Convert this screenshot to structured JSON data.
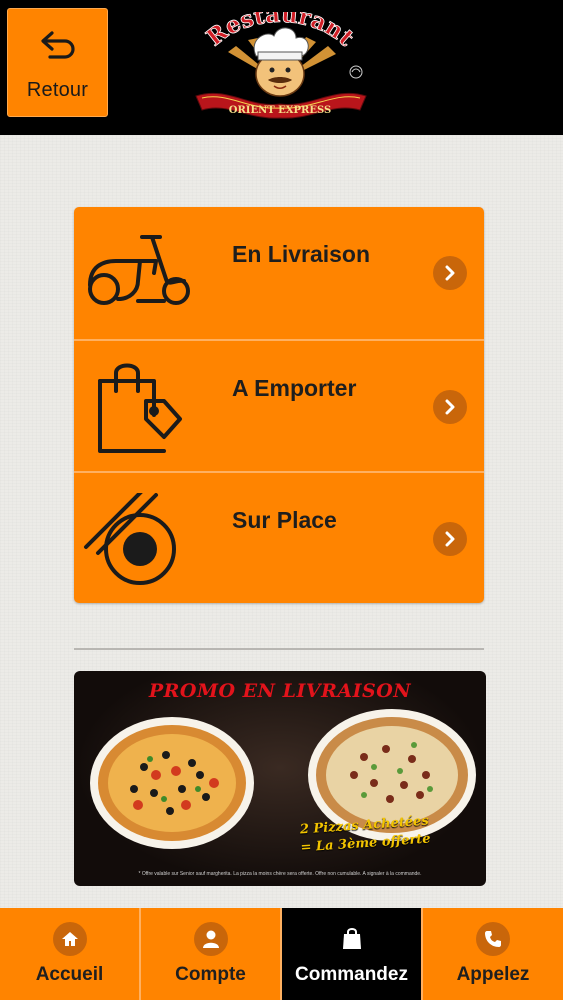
{
  "header": {
    "back_label": "Retour",
    "logo": {
      "top_text": "Restaurant",
      "banner_text": "ORIENT EXPRESS"
    }
  },
  "menu": {
    "items": [
      {
        "label": "En Livraison",
        "icon": "scooter-icon"
      },
      {
        "label": "A Emporter",
        "icon": "shopping-bag-tag-icon"
      },
      {
        "label": "Sur Place",
        "icon": "bowl-chopsticks-icon"
      }
    ],
    "chevron_icon": "chevron-right-icon"
  },
  "promo": {
    "title": "PROMO EN LIVRAISON",
    "offer_line1": "2 Pizzas Achetées",
    "offer_line2": "= La 3ème offerte",
    "fine_print": "* Offre valable sur Senior sauf margherita. La pizza la moins chère sera offerte. Offre non cumulable. A signaler à la commande."
  },
  "bottom_nav": {
    "tabs": [
      {
        "label": "Accueil",
        "icon": "home-icon"
      },
      {
        "label": "Compte",
        "icon": "user-icon"
      },
      {
        "label": "Commandez",
        "icon": "shopping-bag-icon",
        "active": true
      },
      {
        "label": "Appelez",
        "icon": "phone-icon"
      }
    ]
  },
  "colors": {
    "accent": "#ff8400",
    "accent_dark": "#c9660a",
    "header_bg": "#000000",
    "page_bg": "#ecebe7",
    "promo_title": "#e2131b",
    "promo_offer": "#f3c400"
  }
}
